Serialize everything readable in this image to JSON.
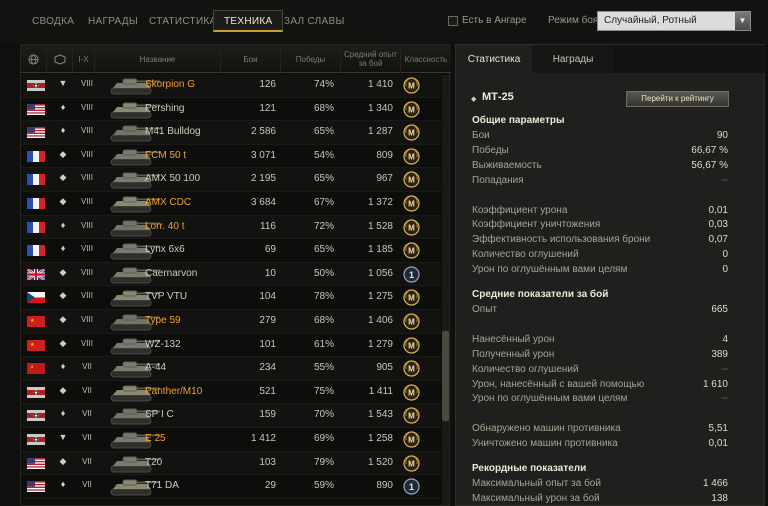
{
  "nav": {
    "tabs": [
      "СВОДКА",
      "НАГРАДЫ",
      "СТАТИСТИКА",
      "ТЕХНИКА",
      "ЗАЛ СЛАВЫ"
    ],
    "active_tab": "ТЕХНИКА",
    "hangar_checkbox_label": "Есть в Ангаре",
    "mode_label": "Режим боя:",
    "mode_value": "Случайный, Ротный"
  },
  "table": {
    "headers": {
      "tier": "I-X",
      "name": "Название",
      "battles": "Бои",
      "wins": "Победы",
      "avg_xp": "Средний опыт за бой",
      "mastery": "Классность"
    },
    "rows": [
      {
        "nation": "germany",
        "type": "▼",
        "tier": "VIII",
        "name": "Skorpion G",
        "premium": true,
        "battles": "126",
        "wins": "74%",
        "xp": "1 410",
        "mastery": "M"
      },
      {
        "nation": "usa",
        "type": "♦",
        "tier": "VIII",
        "name": "Pershing",
        "premium": false,
        "battles": "121",
        "wins": "68%",
        "xp": "1 340",
        "mastery": "M"
      },
      {
        "nation": "usa",
        "type": "♦",
        "tier": "VIII",
        "name": "M41 Bulldog",
        "premium": false,
        "battles": "2 586",
        "wins": "65%",
        "xp": "1 287",
        "mastery": "M"
      },
      {
        "nation": "france",
        "type": "◆",
        "tier": "VIII",
        "name": "FCM 50 t",
        "premium": true,
        "battles": "3 071",
        "wins": "54%",
        "xp": "809",
        "mastery": "M"
      },
      {
        "nation": "france",
        "type": "◆",
        "tier": "VIII",
        "name": "AMX 50 100",
        "premium": false,
        "battles": "2 195",
        "wins": "65%",
        "xp": "967",
        "mastery": "M"
      },
      {
        "nation": "france",
        "type": "◆",
        "tier": "VIII",
        "name": "AMX CDC",
        "premium": true,
        "battles": "3 684",
        "wins": "67%",
        "xp": "1 372",
        "mastery": "M"
      },
      {
        "nation": "france",
        "type": "♦",
        "tier": "VIII",
        "name": "Lorr. 40 t",
        "premium": true,
        "battles": "116",
        "wins": "72%",
        "xp": "1 528",
        "mastery": "M"
      },
      {
        "nation": "france",
        "type": "♦",
        "tier": "VIII",
        "name": "Lynx 6x6",
        "premium": false,
        "battles": "69",
        "wins": "65%",
        "xp": "1 185",
        "mastery": "M"
      },
      {
        "nation": "uk",
        "type": "◆",
        "tier": "VIII",
        "name": "Caernarvon",
        "premium": false,
        "battles": "10",
        "wins": "50%",
        "xp": "1 056",
        "mastery": "1"
      },
      {
        "nation": "czech",
        "type": "◆",
        "tier": "VIII",
        "name": "TVP VTU",
        "premium": false,
        "battles": "104",
        "wins": "78%",
        "xp": "1 275",
        "mastery": "M"
      },
      {
        "nation": "china",
        "type": "◆",
        "tier": "VIII",
        "name": "Type 59",
        "premium": true,
        "battles": "279",
        "wins": "68%",
        "xp": "1 406",
        "mastery": "M"
      },
      {
        "nation": "china",
        "type": "◆",
        "tier": "VIII",
        "name": "WZ-132",
        "premium": false,
        "battles": "101",
        "wins": "61%",
        "xp": "1 279",
        "mastery": "M"
      },
      {
        "nation": "ussr",
        "type": "♦",
        "tier": "VII",
        "name": "A-44",
        "premium": false,
        "battles": "234",
        "wins": "55%",
        "xp": "905",
        "mastery": "M"
      },
      {
        "nation": "germany",
        "type": "◆",
        "tier": "VII",
        "name": "Panther/M10",
        "premium": true,
        "battles": "521",
        "wins": "75%",
        "xp": "1 411",
        "mastery": "M"
      },
      {
        "nation": "germany",
        "type": "♦",
        "tier": "VII",
        "name": "SP I C",
        "premium": false,
        "battles": "159",
        "wins": "70%",
        "xp": "1 543",
        "mastery": "M"
      },
      {
        "nation": "germany",
        "type": "▼",
        "tier": "VII",
        "name": "E 25",
        "premium": true,
        "battles": "1 412",
        "wins": "69%",
        "xp": "1 258",
        "mastery": "M"
      },
      {
        "nation": "usa",
        "type": "◆",
        "tier": "VII",
        "name": "T20",
        "premium": false,
        "battles": "103",
        "wins": "79%",
        "xp": "1 520",
        "mastery": "M"
      },
      {
        "nation": "usa",
        "type": "♦",
        "tier": "VII",
        "name": "T71 DA",
        "premium": false,
        "battles": "29",
        "wins": "59%",
        "xp": "890",
        "mastery": "1"
      }
    ]
  },
  "panel": {
    "tabs": [
      "Статистика",
      "Награды"
    ],
    "vehicle": "МТ-25",
    "rating_button": "Перейти к рейтингу",
    "sections": [
      {
        "title": "Общие параметры",
        "items": [
          {
            "label": "Бои",
            "value": "90"
          },
          {
            "label": "Победы",
            "value": "66,67 %"
          },
          {
            "label": "Выживаемость",
            "value": "56,67 %"
          },
          {
            "label": "Попадания",
            "value": "--"
          },
          {
            "label": "",
            "value": ""
          },
          {
            "label": "Коэффициент урона",
            "value": "0,01"
          },
          {
            "label": "Коэффициент уничтожения",
            "value": "0,03"
          },
          {
            "label": "Эффективность использования брони",
            "value": "0,07"
          },
          {
            "label": "Количество оглушений",
            "value": "0"
          },
          {
            "label": "Урон по оглушённым вами целям",
            "value": "0"
          }
        ]
      },
      {
        "title": "Средние показатели за бой",
        "items": [
          {
            "label": "Опыт",
            "value": "665"
          },
          {
            "label": "",
            "value": ""
          },
          {
            "label": "Нанесённый урон",
            "value": "4"
          },
          {
            "label": "Полученный урон",
            "value": "389"
          },
          {
            "label": "Количество оглушений",
            "value": "--"
          },
          {
            "label": "Урон, нанесённый с вашей помощью",
            "value": "1 610"
          },
          {
            "label": "Урон по оглушённым вами целям",
            "value": "--"
          },
          {
            "label": "",
            "value": ""
          },
          {
            "label": "Обнаружено машин противника",
            "value": "5,51"
          },
          {
            "label": "Уничтожено машин противника",
            "value": "0,01"
          }
        ]
      },
      {
        "title": "Рекордные показатели",
        "items": [
          {
            "label": "Максимальный опыт за бой",
            "value": "1 466"
          },
          {
            "label": "Максимальный урон за бой",
            "value": "138"
          }
        ]
      }
    ]
  }
}
